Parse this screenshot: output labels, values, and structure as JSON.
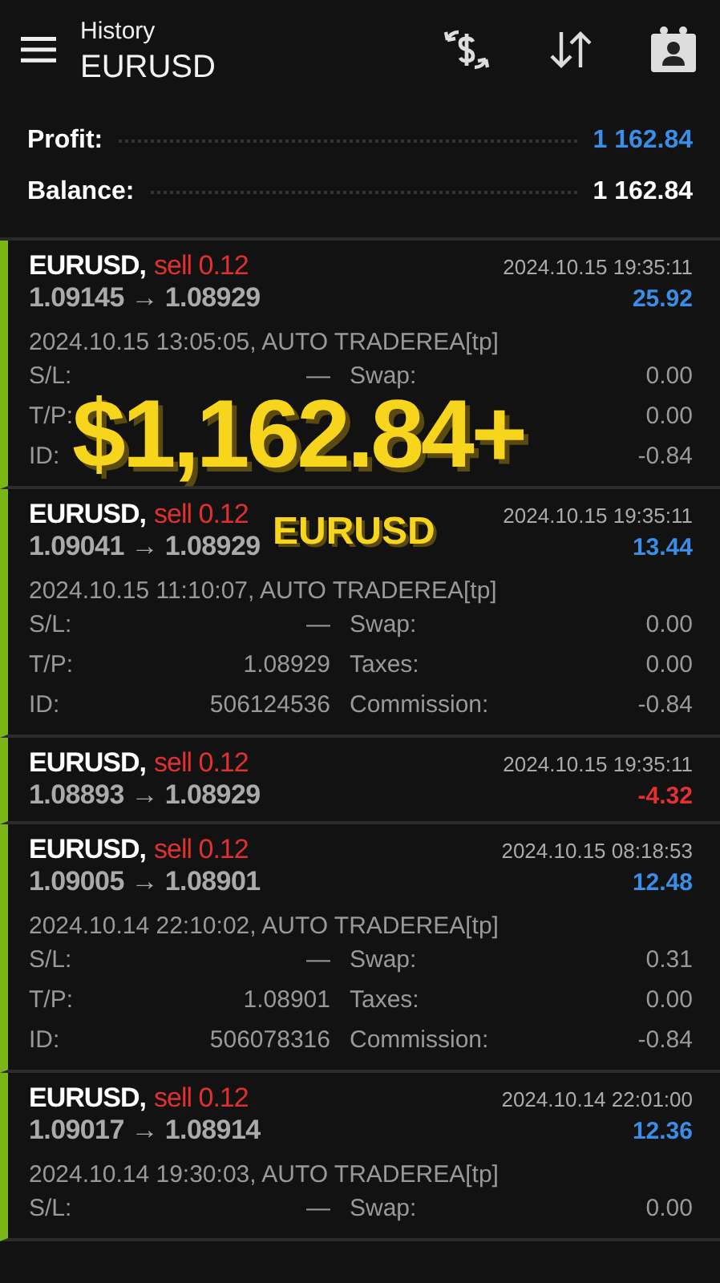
{
  "header": {
    "title": "History",
    "subtitle": "EURUSD"
  },
  "summary": [
    {
      "label": "Profit:",
      "value": "1 162.84",
      "highlight": true
    },
    {
      "label": "Balance:",
      "value": "1 162.84",
      "highlight": false
    }
  ],
  "trades": [
    {
      "symbol": "EURUSD,",
      "type": "sell 0.12",
      "prices": "1.09145 → 1.08929",
      "close_time": "2024.10.15 19:35:11",
      "profit": "25.92",
      "loss": false,
      "expanded": true,
      "comment": "2024.10.15 13:05:05, AUTO TRADEREA[tp]",
      "details": [
        {
          "label": "S/L:",
          "value": "—",
          "label2": "Swap:",
          "value2": "0.00"
        },
        {
          "label": "T/P:",
          "value2": "0.00"
        },
        {
          "label": "ID:",
          "value2": "-0.84"
        }
      ]
    },
    {
      "symbol": "EURUSD,",
      "type": "sell 0.12",
      "prices": "1.09041 → 1.08929",
      "close_time": "2024.10.15 19:35:11",
      "profit": "13.44",
      "loss": false,
      "expanded": true,
      "comment": "2024.10.15 11:10:07, AUTO TRADEREA[tp]",
      "details": [
        {
          "label": "S/L:",
          "value": "—",
          "label2": "Swap:",
          "value2": "0.00"
        },
        {
          "label": "T/P:",
          "value": "1.08929",
          "label2": "Taxes:",
          "value2": "0.00"
        },
        {
          "label": "ID:",
          "value": "506124536",
          "label2": "Commission:",
          "value2": "-0.84"
        }
      ]
    },
    {
      "symbol": "EURUSD,",
      "type": "sell 0.12",
      "prices": "1.08893 → 1.08929",
      "close_time": "2024.10.15 19:35:11",
      "profit": "-4.32",
      "loss": true,
      "expanded": false
    },
    {
      "symbol": "EURUSD,",
      "type": "sell 0.12",
      "prices": "1.09005 → 1.08901",
      "close_time": "2024.10.15 08:18:53",
      "profit": "12.48",
      "loss": false,
      "expanded": true,
      "comment": "2024.10.14 22:10:02, AUTO TRADEREA[tp]",
      "details": [
        {
          "label": "S/L:",
          "value": "—",
          "label2": "Swap:",
          "value2": "0.31"
        },
        {
          "label": "T/P:",
          "value": "1.08901",
          "label2": "Taxes:",
          "value2": "0.00"
        },
        {
          "label": "ID:",
          "value": "506078316",
          "label2": "Commission:",
          "value2": "-0.84"
        }
      ]
    },
    {
      "symbol": "EURUSD,",
      "type": "sell 0.12",
      "prices": "1.09017 → 1.08914",
      "close_time": "2024.10.14 22:01:00",
      "profit": "12.36",
      "loss": false,
      "expanded": true,
      "comment": "2024.10.14 19:30:03, AUTO TRADEREA[tp]",
      "details": [
        {
          "label": "S/L:",
          "value": "—",
          "label2": "Swap:",
          "value2": "0.00"
        }
      ]
    }
  ],
  "overlay": {
    "headline": "$1,162.84+",
    "caption": "EURUSD"
  }
}
